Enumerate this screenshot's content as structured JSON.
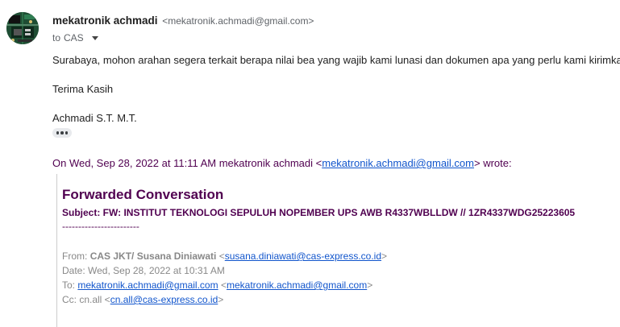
{
  "sender": {
    "name": "mekatronik achmadi",
    "email": "<mekatronik.achmadi@gmail.com>"
  },
  "recipients": {
    "prefix": "to",
    "name": "CAS"
  },
  "body": {
    "paragraph": "Surabaya, mohon arahan segera terkait berapa nilai bea yang wajib kami lunasi dan dokumen apa yang perlu kami kirimkan",
    "closing": "Terima Kasih",
    "signature": "Achmadi S.T. M.T."
  },
  "quote": {
    "intro": "On Wed, Sep 28, 2022 at 11:11 AM mekatronik achmadi <",
    "email": "mekatronik.achmadi@gmail.com",
    "outro": "> wrote:"
  },
  "forwarded": {
    "title": "Forwarded Conversation",
    "subject": "Subject: FW: INSTITUT TEKNOLOGI SEPULUH NOPEMBER UPS AWB R4337WBLLDW // 1ZR4337WDG25223605",
    "divider": "------------------------",
    "from_label": "From:",
    "from_name": "CAS JKT/ Susana Diniawati",
    "from_open": "<",
    "from_email": "susana.diniawati@cas-express.co.id",
    "from_close": ">",
    "date_text": "Date: Wed, Sep 28, 2022 at 10:31 AM",
    "to_label": "To:",
    "to_email1": "mekatronik.achmadi@gmail.com",
    "to_open": "<",
    "to_email2": "mekatronik.achmadi@gmail.com",
    "to_close": ">",
    "cc_label": "Cc: cn.all <",
    "cc_email": "cn.all@cas-express.co.id",
    "cc_close": ">"
  },
  "colors": {
    "link": "#1155cc",
    "quote_purple": "#500050",
    "meta_gray": "#888888"
  },
  "icons": {
    "avatar": "circuit-board-avatar",
    "recipient_menu": "caret-down-icon",
    "show_trimmed": "ellipsis-icon"
  }
}
